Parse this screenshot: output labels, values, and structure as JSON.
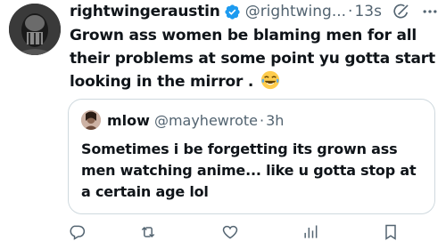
{
  "tweet": {
    "display_name": "rightwingeraustin",
    "handle": "@rightwing...",
    "separator": "·",
    "time": "13s",
    "text": "Grown ass women be blaming men for all their problems at some point yu gotta start looking in the mirror .",
    "emoji": "face-with-tears-of-joy",
    "icons": [
      "verified-badge-icon",
      "grok-icon",
      "more-icon"
    ]
  },
  "quote": {
    "display_name": "mlow",
    "handle": "@mayhewrote",
    "separator": "·",
    "time": "3h",
    "text": "Sometimes i be forgetting its grown ass men watching anime... like u gotta stop at a certain age lol"
  },
  "actions": {
    "icons": [
      "reply-icon",
      "retweet-icon",
      "like-icon",
      "views-icon",
      "bookmark-icon"
    ]
  },
  "colors": {
    "text": "#0f1419",
    "secondary": "#536471",
    "verified": "#1d9bf0",
    "border": "#cfd9de"
  }
}
